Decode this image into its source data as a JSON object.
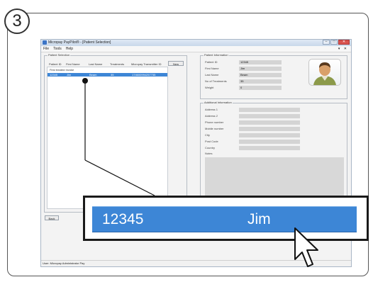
{
  "step": {
    "number": "3"
  },
  "window": {
    "title": "Micropay PayPilot® - [Patient Selection]",
    "menu": [
      "File",
      "Tools",
      "Help"
    ],
    "menu_right": "▾ ✕"
  },
  "patient_selection": {
    "legend": "Patient Selection",
    "columns": [
      "Patient ID",
      "First Name",
      "Last Name",
      "Treatments",
      "Micropay Transmitter ID"
    ],
    "new_button": "New",
    "filter_label": "First treated Invoke",
    "selected_row": [
      "12345",
      "Jim",
      "Beam",
      "35",
      "174600994257735"
    ]
  },
  "patient_information": {
    "legend": "Patient Information",
    "fields": [
      {
        "label": "Patient ID",
        "value": "12345"
      },
      {
        "label": "First Name",
        "value": "Jim"
      },
      {
        "label": "Last Name",
        "value": "Beam"
      },
      {
        "label": "No of Treatments",
        "value": "35"
      },
      {
        "label": "Weight",
        "value": "0"
      }
    ]
  },
  "additional_information": {
    "legend": "Additional Information",
    "fields": [
      "Address 1",
      "Address 2",
      "Phone number",
      "Mobile number",
      "City",
      "Post Code",
      "Country",
      "Notes"
    ]
  },
  "footer": {
    "back_button": "Back",
    "status": "User: Micropay Administrator   Pay"
  },
  "zoom": {
    "patient_id": "12345",
    "first_name": "Jim"
  },
  "colors": {
    "selection": "#3d86d6",
    "frame_border": "#555555"
  }
}
